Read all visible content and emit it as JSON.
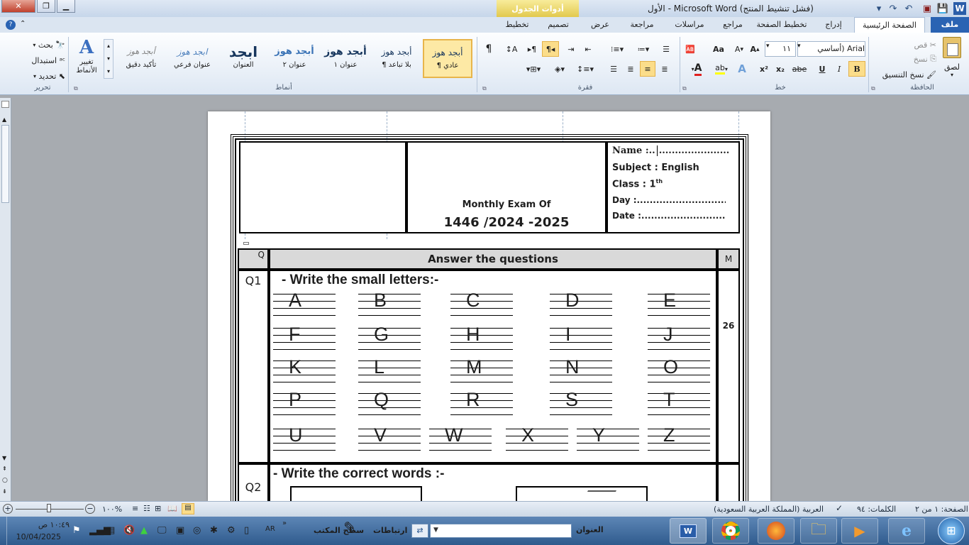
{
  "window": {
    "title": "الأول - Microsoft Word (فشل تنشيط المنتج)",
    "context_tab_group": "أدوات الجدول"
  },
  "tabs": [
    "ملف",
    "الصفحة الرئيسية",
    "إدراج",
    "تخطيط الصفحة",
    "مراجع",
    "مراسلات",
    "مراجعة",
    "عرض",
    "تصميم",
    "تخطيط"
  ],
  "ribbon": {
    "clipboard": {
      "label": "الحافظة",
      "paste": "لصق",
      "cut": "قص",
      "copy": "نسخ",
      "format_painter": "نسخ التنسيق"
    },
    "font": {
      "label": "خط",
      "family": "Arial (أساسي ص",
      "size": "١١",
      "bold": "B",
      "italic": "I",
      "underline": "U",
      "strike": "abe",
      "subscript": "x₂",
      "superscript": "x²",
      "grow": "A",
      "shrink": "A",
      "case": "Aa",
      "clear": "A"
    },
    "paragraph": {
      "label": "فقرة"
    },
    "styles": {
      "label": "أنماط",
      "items": [
        {
          "preview": "أبجد هوز",
          "name": "¶ عادي"
        },
        {
          "preview": "أبجد هوز",
          "name": "¶ بلا تباعد"
        },
        {
          "preview": "أبجد هوز",
          "name": "عنوان ١"
        },
        {
          "preview": "أبجد هوز",
          "name": "عنوان ٢"
        },
        {
          "preview": "ابجد",
          "name": "العنوان"
        },
        {
          "preview": "ابجد هوز",
          "name": "عنوان فرعي"
        },
        {
          "preview": "أبجد هوز",
          "name": "تأكيد دقيق"
        }
      ],
      "change_styles": "تغيير الأنماط"
    },
    "editing": {
      "label": "تحرير",
      "find": "بحث",
      "replace": "استبدال",
      "select": "تحديد"
    }
  },
  "document": {
    "header": {
      "name": "Name :..",
      "name_dots": "......................",
      "subject": "Subject : English",
      "class": "Class : 1",
      "class_sup": "th",
      "day": "Day  :....................................",
      "date": "Date :.....................................",
      "exam_title": "Monthly Exam Of",
      "exam_year": "1446 /2024 -2025"
    },
    "table_header": {
      "q": "Q",
      "title": "Answer the questions",
      "m": "M"
    },
    "q1": {
      "label": "Q1",
      "instruction": "- Write  the small letters:-",
      "mark": "26",
      "letters": [
        "A",
        "B",
        "C",
        "D",
        "E",
        "F",
        "G",
        "H",
        "I",
        "J",
        "K",
        "L",
        "M",
        "N",
        "O",
        "P",
        "Q",
        "R",
        "S",
        "T",
        "U",
        "V",
        "W",
        "X",
        "Y",
        "Z"
      ]
    },
    "q2": {
      "label": "Q2",
      "instruction": "- Write the correct words :-"
    }
  },
  "statusbar": {
    "page": "الصفحة: ١ من ٢",
    "words": "الكلمات: ٩٤",
    "language": "العربية (المملكة العربية السعودية)",
    "zoom": "١٠٠%"
  },
  "taskbar": {
    "time": "١٠:٤٩ ص",
    "date": "10/04/2025",
    "lang": "AR",
    "desktop": "سطح المكتب",
    "links": "ارتباطات",
    "address_label": "العنوان"
  },
  "colors": {
    "ribbon_accent": "#2a63b3",
    "context_tab": "#e2c94e",
    "taskbar": "#3c6a9e"
  }
}
